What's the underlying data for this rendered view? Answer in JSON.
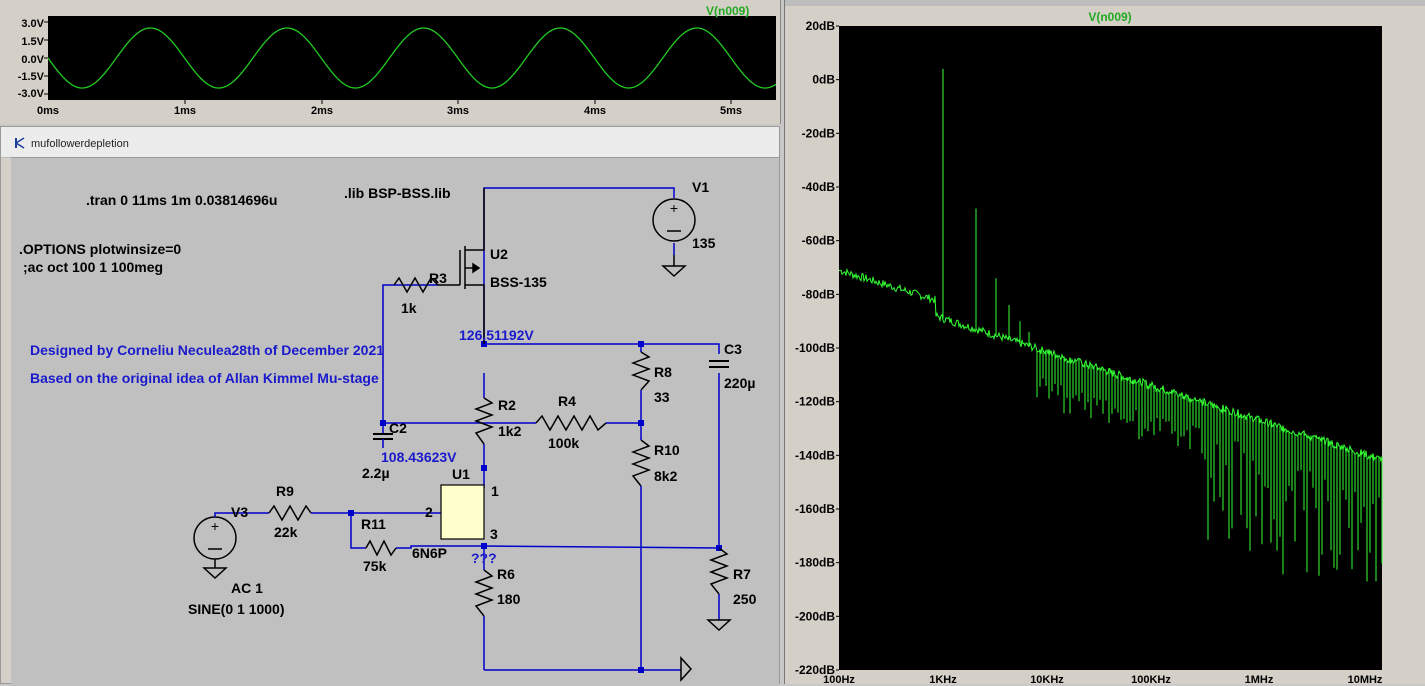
{
  "waveform": {
    "trace_label": "V(n009)",
    "y_ticks": [
      "3.0V",
      "1.5V",
      "0.0V",
      "-1.5V",
      "-3.0V"
    ],
    "x_ticks": [
      "0ms",
      "1ms",
      "2ms",
      "3ms",
      "4ms",
      "5ms"
    ]
  },
  "schematic": {
    "window_title": "mufollowerdepletion",
    "directives": {
      "tran": ".tran 0 11ms 1m 0.03814696u",
      "lib": ".lib BSP-BSS.lib",
      "options": ".OPTIONS plotwinsize=0",
      "ac": ";ac oct 100 1 100meg"
    },
    "comments": {
      "designer": "Designed by Corneliu Neculea28th of December 2021",
      "based_on": "Based on the original idea of Allan Kimmel Mu-stage"
    },
    "node_voltages": {
      "top": "126.51192V",
      "mid": "108.43623V",
      "unknown": "???"
    },
    "components": {
      "v1_name": "V1",
      "v1_value": "135",
      "u2_name": "U2",
      "u2_value": "BSS-135",
      "r3_name": "R3",
      "r3_value": "1k",
      "r8_name": "R8",
      "r8_value": "33",
      "c3_name": "C3",
      "c3_value": "220µ",
      "r2_name": "R2",
      "r2_value": "1k2",
      "r4_name": "R4",
      "r4_value": "100k",
      "c2_name": "C2",
      "c2_value": "2.2µ",
      "r10_name": "R10",
      "r10_value": "8k2",
      "u1_name": "U1",
      "u1_value": "6N6P",
      "pin1": "1",
      "pin2": "2",
      "pin3": "3",
      "r9_name": "R9",
      "r9_value": "22k",
      "v3_name": "V3",
      "v3_ac": "AC 1",
      "v3_sine": "SINE(0 1 1000)",
      "r11_name": "R11",
      "r11_value": "75k",
      "r6_name": "R6",
      "r6_value": "180",
      "r7_name": "R7",
      "r7_value": "250"
    }
  },
  "fft": {
    "trace_label": "V(n009)",
    "y_ticks": [
      "20dB",
      "0dB",
      "-20dB",
      "-40dB",
      "-60dB",
      "-80dB",
      "-100dB",
      "-120dB",
      "-140dB",
      "-160dB",
      "-180dB",
      "-200dB",
      "-220dB"
    ],
    "x_ticks": [
      "100Hz",
      "1KHz",
      "10KHz",
      "100KHz",
      "1MHz",
      "10MHz"
    ]
  },
  "colors": {
    "trace_green": "#33ff33",
    "wave_green": "#22cc22",
    "wire_blue": "#0000cc",
    "plot_bg": "#000000"
  }
}
